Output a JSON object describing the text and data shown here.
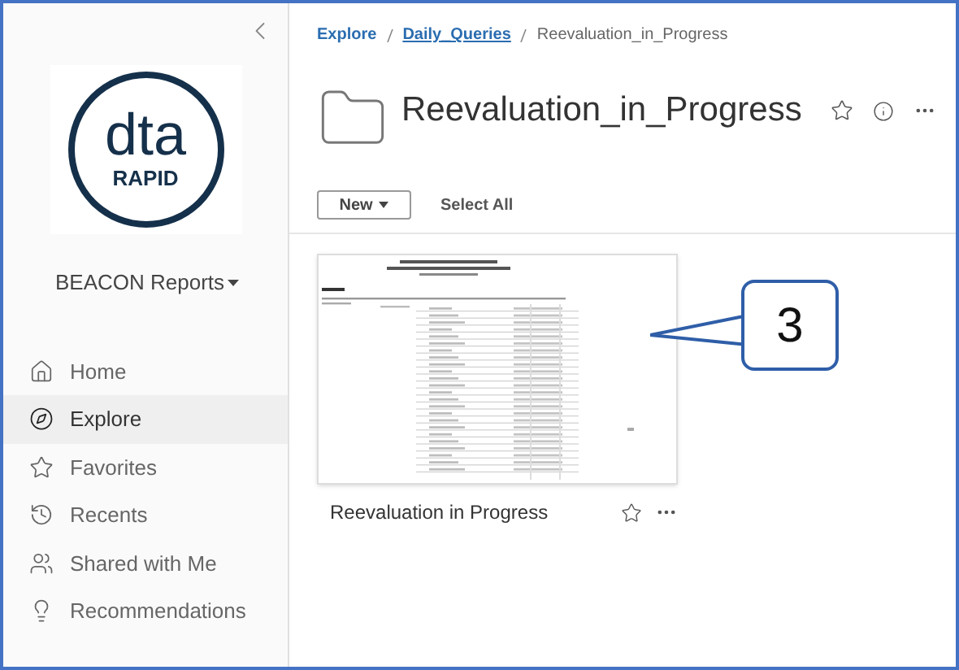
{
  "sidebar": {
    "account": "BEACON Reports",
    "items": [
      {
        "label": "Home",
        "kind": "home",
        "selected": false
      },
      {
        "label": "Explore",
        "kind": "explore",
        "selected": true
      },
      {
        "label": "Favorites",
        "kind": "favorites",
        "selected": false
      },
      {
        "label": "Recents",
        "kind": "recents",
        "selected": false
      },
      {
        "label": "Shared with Me",
        "kind": "shared",
        "selected": false
      },
      {
        "label": "Recommendations",
        "kind": "recommendations",
        "selected": false
      }
    ]
  },
  "logo": {
    "top": "dta",
    "bottom": "RAPID"
  },
  "breadcrumb": [
    {
      "label": "Explore",
      "kind": "link"
    },
    {
      "label": "Daily_Queries",
      "kind": "underlined"
    },
    {
      "label": "Reevaluation_in_Progress",
      "kind": "current"
    }
  ],
  "page_title": "Reevaluation_in_Progress",
  "toolbar": {
    "new_button": "New",
    "select_all": "Select All"
  },
  "cards": [
    {
      "title": "Reevaluation in Progress",
      "kind": "picture"
    }
  ],
  "callout": {
    "label": "3"
  }
}
